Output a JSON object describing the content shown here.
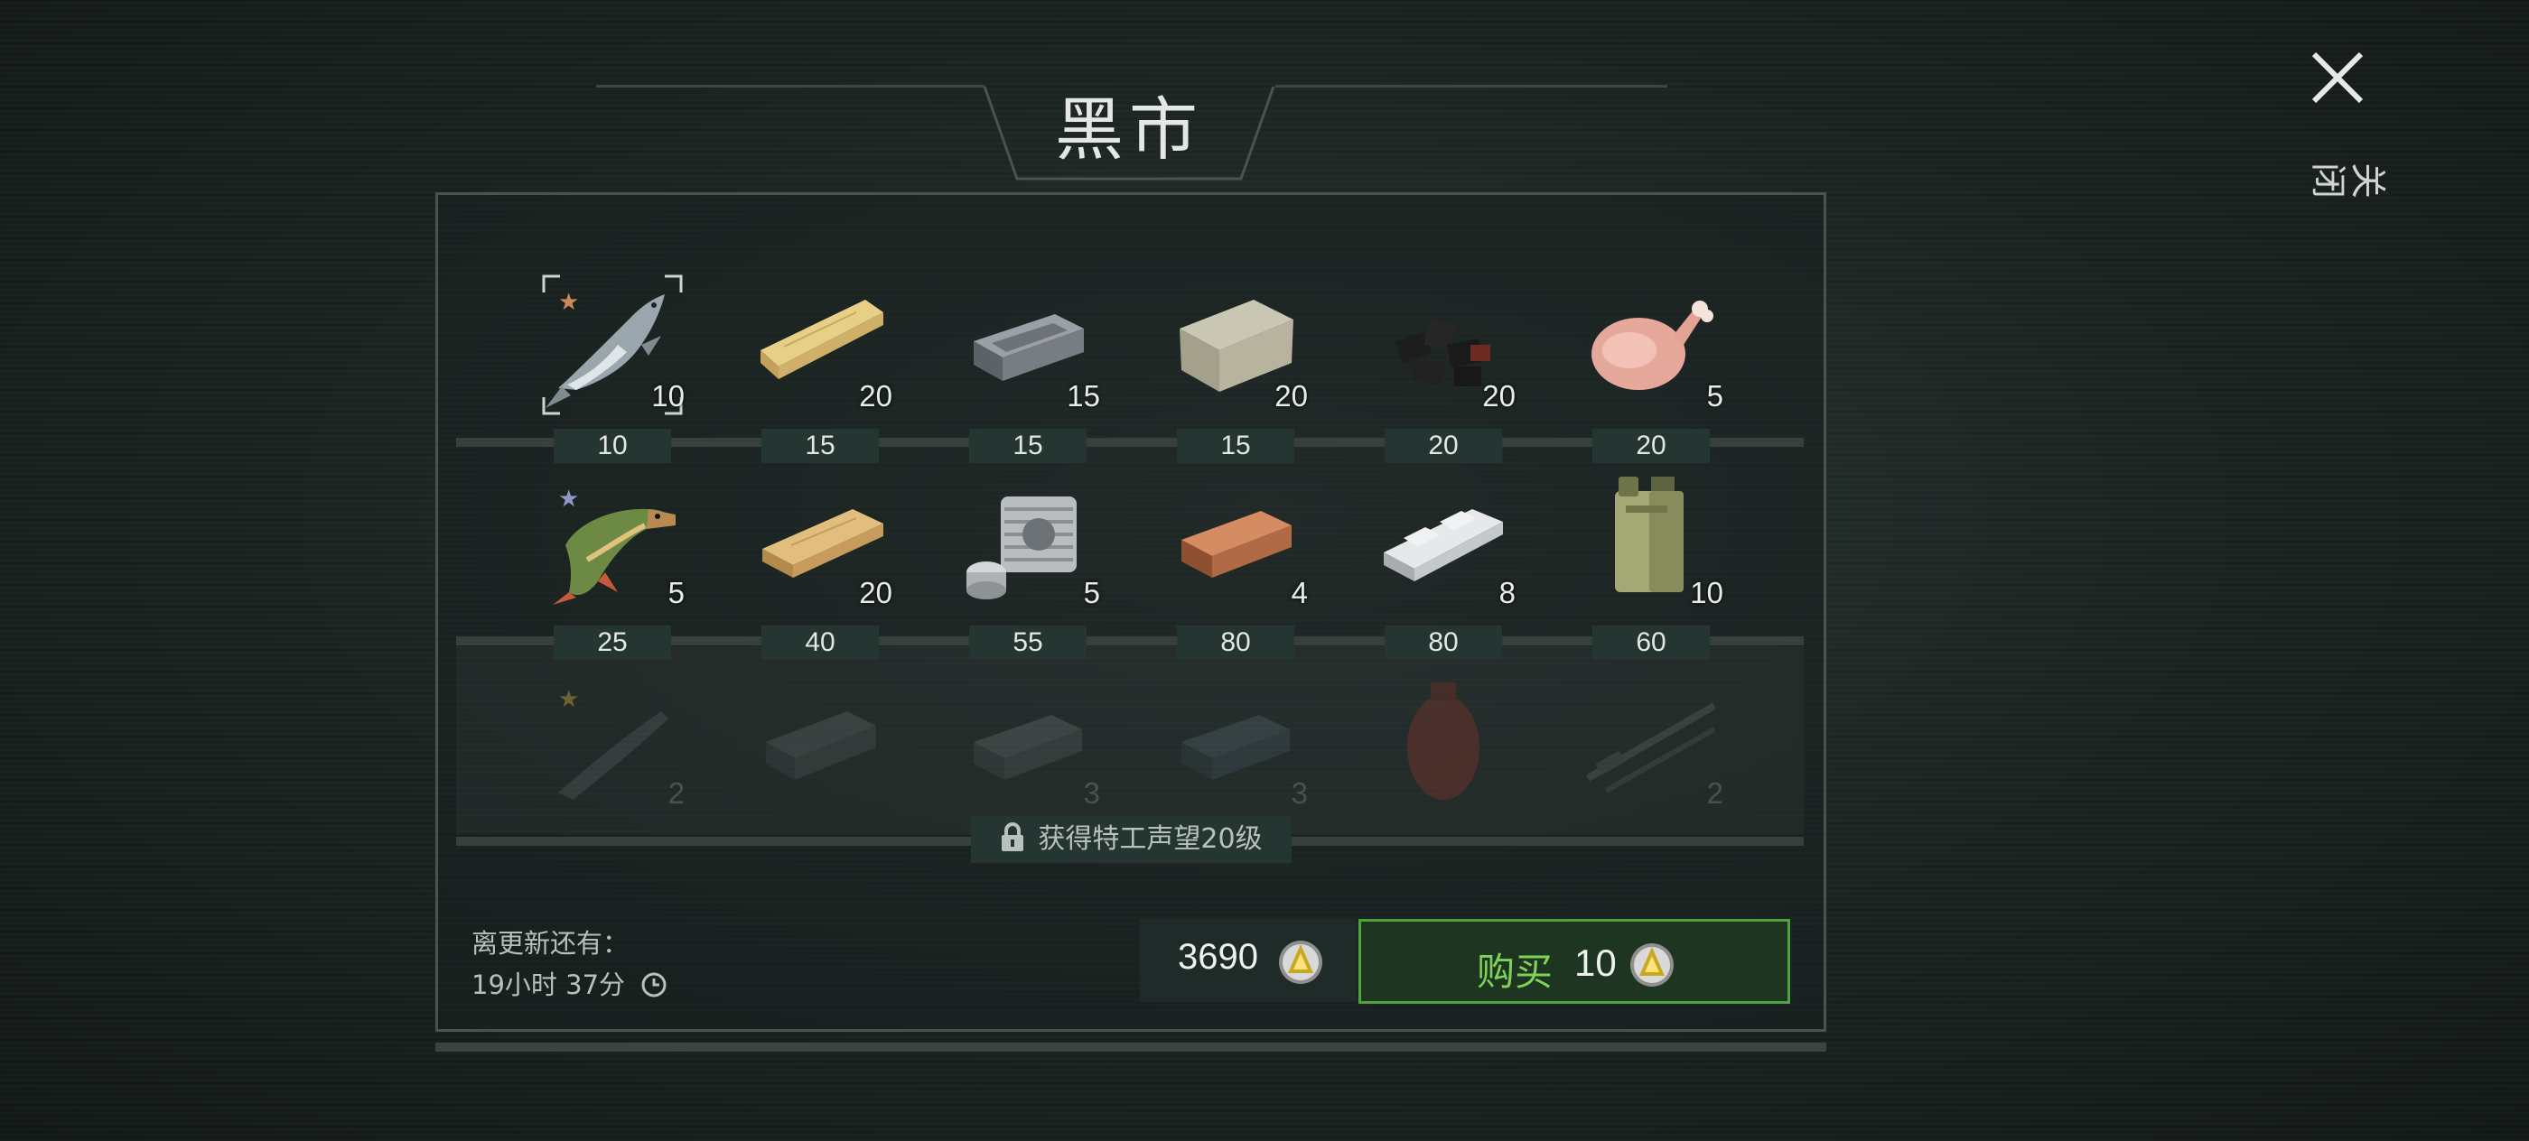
{
  "title": "黑市",
  "close_label": "关闭",
  "rows": [
    {
      "locked": false,
      "items": [
        {
          "icon": "fish-salmon-icon",
          "qty": "10",
          "price": "10",
          "star": "bronze",
          "selected": true
        },
        {
          "icon": "wood-plank-icon",
          "qty": "20",
          "price": "15"
        },
        {
          "icon": "iron-ingot-icon",
          "qty": "15",
          "price": "15"
        },
        {
          "icon": "stone-block-icon",
          "qty": "20",
          "price": "15"
        },
        {
          "icon": "coal-icon",
          "qty": "20",
          "price": "20"
        },
        {
          "icon": "raw-chicken-icon",
          "qty": "5",
          "price": "20"
        }
      ]
    },
    {
      "locked": false,
      "items": [
        {
          "icon": "fish-pike-icon",
          "qty": "5",
          "price": "25",
          "star": "silver"
        },
        {
          "icon": "wood-board-icon",
          "qty": "20",
          "price": "40"
        },
        {
          "icon": "engine-cylinder-icon",
          "qty": "5",
          "price": "55"
        },
        {
          "icon": "copper-ingot-icon",
          "qty": "4",
          "price": "80"
        },
        {
          "icon": "aluminum-bar-icon",
          "qty": "8",
          "price": "80"
        },
        {
          "icon": "jerry-can-icon",
          "qty": "10",
          "price": "60"
        }
      ]
    },
    {
      "locked": true,
      "items": [
        {
          "icon": "fish-sturgeon-icon",
          "qty": "2",
          "star": "gold"
        },
        {
          "icon": "dark-ingot-icon",
          "qty": ""
        },
        {
          "icon": "steel-ingot-icon",
          "qty": "3"
        },
        {
          "icon": "titanium-ingot-icon",
          "qty": "3"
        },
        {
          "icon": "gas-cylinder-icon",
          "qty": ""
        },
        {
          "icon": "rifle-parts-icon",
          "qty": "2"
        }
      ]
    }
  ],
  "lock_requirement": "获得特工声望20级",
  "refresh": {
    "label": "离更新还有：",
    "time": "19小时 37分"
  },
  "balance": "3690",
  "buy": {
    "label": "购买",
    "amount": "10"
  },
  "colors": {
    "accent_green": "#7ed257",
    "buy_border": "#4fa33c",
    "price_bg": "#243532"
  }
}
